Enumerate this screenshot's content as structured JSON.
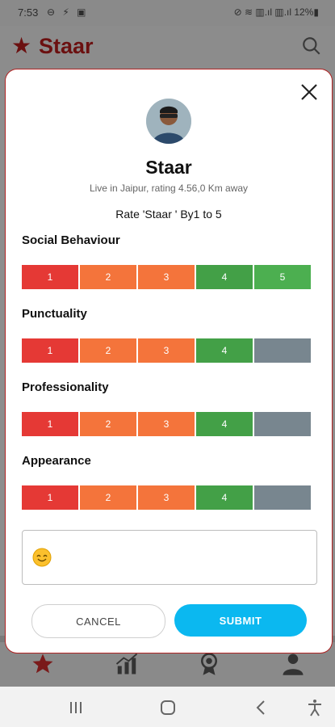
{
  "status_bar": {
    "time": "7:53",
    "left_icons": "⊖ ⚡ ▣",
    "right_icons": "⊘ ≋ ▥.ıl ▥.ıl 12%▮"
  },
  "app_bar": {
    "title": "Staar"
  },
  "dialog": {
    "name": "Staar",
    "subtitle": "Live in Jaipur, rating 4.56,0 Km away",
    "rate_heading": "Rate 'Staar  ' By1 to 5",
    "categories": [
      {
        "label": "Social Behaviour",
        "cells": [
          "1",
          "2",
          "3",
          "4",
          "5"
        ],
        "selected": 5
      },
      {
        "label": "Punctuality",
        "cells": [
          "1",
          "2",
          "3",
          "4",
          ""
        ],
        "selected": 4
      },
      {
        "label": "Professionality",
        "cells": [
          "1",
          "2",
          "3",
          "4",
          ""
        ],
        "selected": 4
      },
      {
        "label": "Appearance",
        "cells": [
          "1",
          "2",
          "3",
          "4",
          ""
        ],
        "selected": 4
      }
    ],
    "comment_value": "",
    "cancel_label": "CANCEL",
    "submit_label": "SUBMIT"
  },
  "colors": {
    "brand": "#b02323",
    "rating_1": "#e53935",
    "rating_2": "#f4743b",
    "rating_3": "#f4743b",
    "rating_4": "#43a047",
    "rating_5": "#4caf50",
    "unselected": "#78868f",
    "submit": "#0bb8f0"
  }
}
